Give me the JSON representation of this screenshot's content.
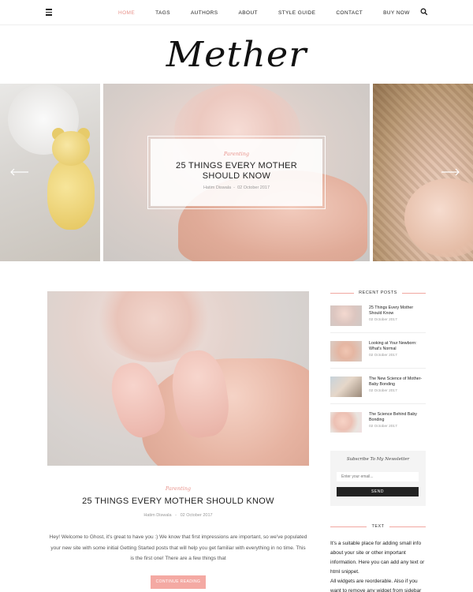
{
  "nav": {
    "items": [
      "HOME",
      "TAGS",
      "AUTHORS",
      "ABOUT",
      "STYLE GUIDE",
      "CONTACT",
      "BUY NOW"
    ],
    "active_index": 0,
    "menu_icon": "hamburger-icon",
    "search_icon": "search-icon"
  },
  "logo": {
    "text": "Mether"
  },
  "slider": {
    "featured": {
      "category": "Parenting",
      "title": "25 THINGS EVERY MOTHER SHOULD KNOW",
      "author": "Hatim Diswala",
      "separator": "-",
      "date": "02 October 2017"
    },
    "prev_icon": "arrow-left-icon",
    "next_icon": "arrow-right-icon"
  },
  "post": {
    "category": "Parenting",
    "title": "25 THINGS EVERY MOTHER SHOULD KNOW",
    "author": "Hatim Diswala",
    "separator": "-",
    "date": "02 October 2017",
    "excerpt": "Hey! Welcome to Ghost, it's great to have you :) We know that first impressions are important, so we've populated your new site with some initial Getting Started posts that will help you get familiar with everything in no time. This is the first one! There are a few things that",
    "continue_label": "CONTINUE READING"
  },
  "sidebar": {
    "recent_title": "RECENT POSTS",
    "recent_posts": [
      {
        "title": "25 Things Every Mother Should Know",
        "date": "02 October 2017"
      },
      {
        "title": "Looking at Your Newborn: What's Normal",
        "date": "02 October 2017"
      },
      {
        "title": "The New Science of Mother-Baby Bonding",
        "date": "02 October 2017"
      },
      {
        "title": "The Science Behind Baby Bonding",
        "date": "02 October 2017"
      }
    ],
    "newsletter": {
      "title": "Subscribe To My Newsletter",
      "placeholder": "Enter your email...",
      "button": "SEND"
    },
    "text_title": "TEXT",
    "text_body": "It's a suitable place for adding small info about your site or other important information. Here you can add any text or html snippet.",
    "text_body2": "All widgets are reorderable. Also if you want to remove any widget from sidebar"
  },
  "colors": {
    "accent": "#e8928b",
    "button": "#f4a9a3",
    "dark": "#222222"
  }
}
